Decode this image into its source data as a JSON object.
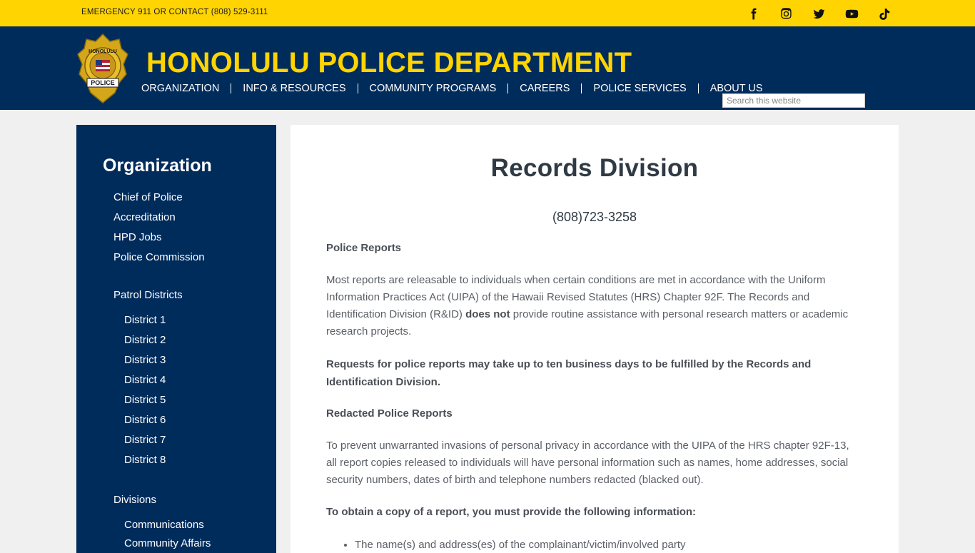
{
  "topbar": {
    "emergency": "EMERGENCY  911 OR CONTACT (808) 529-3111",
    "social": [
      "facebook-icon",
      "instagram-icon",
      "twitter-icon",
      "youtube-icon",
      "tiktok-icon"
    ]
  },
  "header": {
    "title": "HONOLULU POLICE DEPARTMENT",
    "badge_text_top": "HONOLULU",
    "badge_text_bottom": "POLICE",
    "nav": [
      "ORGANIZATION",
      "INFO & RESOURCES",
      "COMMUNITY PROGRAMS",
      "CAREERS",
      "POLICE SERVICES",
      "ABOUT US"
    ],
    "search_placeholder": "Search this website"
  },
  "sidebar": {
    "title": "Organization",
    "links": [
      "Chief of Police",
      "Accreditation",
      "HPD Jobs",
      "Police Commission"
    ],
    "patrol_heading": "Patrol Districts",
    "districts": [
      "District 1",
      "District 2",
      "District 3",
      "District 4",
      "District 5",
      "District 6",
      "District 7",
      "District 8"
    ],
    "divisions_heading": "Divisions",
    "divisions": [
      "Communications",
      "Community Affairs"
    ]
  },
  "main": {
    "title": "Records Division",
    "phone": "(808)723-3258",
    "police_reports_heading": "Police Reports",
    "para1_a": "Most reports are releasable to individuals when certain conditions are met in accordance with the Uniform Information Practices Act (UIPA) of the Hawaii Revised Statutes (HRS) Chapter 92F.  The Records and Identification Division (R&ID) ",
    "para1_bold": "does not",
    "para1_b": " provide routine assistance with personal research matters or academic research projects.",
    "para2": "Requests for police reports may take up to ten business days to be fulfilled by the Records and Identification Division.",
    "redacted_heading": "Redacted Police Reports",
    "para3": "To prevent unwarranted invasions of personal privacy in accordance with the UIPA of the HRS chapter 92F-13, all report copies released to individuals will have personal information such as names, home addresses, social security numbers, dates of birth and telephone numbers redacted (blacked out).",
    "para4": "To obtain a copy of a report, you must provide the following information:",
    "bullets": [
      "The name(s) and address(es) of the complainant/victim/involved party"
    ]
  },
  "colors": {
    "topbar": "#ffd400",
    "header": "#002c5c",
    "title": "#ffd400"
  }
}
